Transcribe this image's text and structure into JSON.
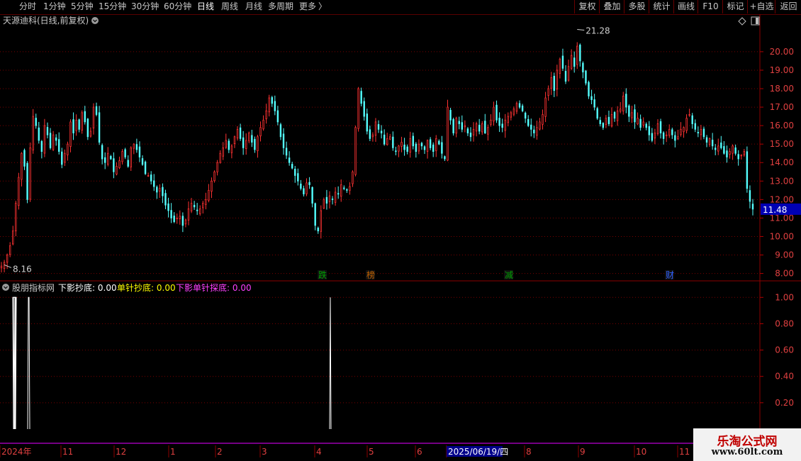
{
  "toolbar": {
    "periods": [
      "分时",
      "1分钟",
      "5分钟",
      "15分钟",
      "30分钟",
      "60分钟",
      "日线",
      "周线",
      "月线",
      "多周期",
      "更多"
    ],
    "active": "日线",
    "more_arrow": "〉",
    "right_buttons": [
      "复权",
      "叠加",
      "多股",
      "统计",
      "画线",
      "F10",
      "标记",
      "+自选",
      "返回"
    ]
  },
  "main_panel": {
    "title": "天源迪科(日线,前复权)",
    "high_label": "21.28",
    "low_label": "8.16",
    "current_price": "11.48",
    "y_ticks": [
      "20.00",
      "19.00",
      "18.00",
      "17.00",
      "16.00",
      "15.00",
      "14.00",
      "13.00",
      "12.00",
      "11.00",
      "10.00",
      "9.00",
      "8.00"
    ],
    "event_markers": [
      "跌",
      "榜",
      "减",
      "财"
    ]
  },
  "indicator_panel": {
    "name": "股朋指标网",
    "series": [
      {
        "name": "下影抄底",
        "value": "0.00",
        "color": "#ffffff"
      },
      {
        "name": "单针抄底",
        "value": "0.00",
        "color": "#ffff00"
      },
      {
        "name": "下影单针探底",
        "value": "0.00",
        "color": "#ff40ff"
      }
    ],
    "y_ticks": [
      "1.00",
      "0.80",
      "0.60",
      "0.40",
      "0.20"
    ]
  },
  "x_axis": {
    "labels": [
      "2024年",
      "11",
      "12",
      "1",
      "2",
      "3",
      "4",
      "5",
      "6",
      "2025/06/19/四",
      "8",
      "9",
      "10",
      "11"
    ]
  },
  "watermark": {
    "title": "乐淘公式网",
    "url": "www.60lt.com"
  },
  "chart_data": {
    "type": "candlestick",
    "price_ylim": [
      7.6,
      21.8
    ],
    "indicator_ylim": [
      0,
      1.05
    ],
    "closes": [
      8.4,
      8.6,
      9.0,
      9.5,
      10.3,
      11.8,
      13.2,
      14.5,
      13.8,
      12.0,
      14.8,
      16.5,
      16.0,
      15.2,
      14.6,
      16.0,
      15.5,
      14.8,
      15.5,
      15.2,
      14.6,
      13.9,
      14.5,
      15.0,
      16.2,
      15.6,
      16.3,
      15.8,
      16.7,
      16.2,
      15.4,
      15.7,
      17.0,
      16.6,
      15.1,
      14.2,
      14.0,
      14.5,
      14.2,
      13.5,
      13.8,
      14.1,
      14.6,
      14.3,
      13.8,
      14.8,
      15.0,
      14.7,
      14.3,
      13.9,
      13.4,
      13.3,
      13.0,
      12.7,
      12.4,
      12.6,
      12.2,
      11.7,
      11.4,
      11.0,
      10.8,
      11.0,
      11.1,
      10.6,
      10.9,
      11.5,
      11.8,
      11.6,
      11.4,
      11.5,
      11.8,
      12.0,
      12.5,
      13.0,
      13.5,
      14.0,
      14.5,
      14.8,
      15.2,
      14.7,
      14.9,
      15.4,
      15.8,
      15.3,
      14.8,
      15.2,
      15.6,
      15.1,
      14.7,
      15.4,
      15.9,
      16.3,
      16.8,
      17.5,
      17.2,
      16.8,
      16.2,
      15.4,
      14.8,
      14.4,
      14.0,
      13.7,
      13.3,
      13.0,
      12.6,
      12.3,
      12.9,
      12.8,
      11.8,
      10.6,
      10.3,
      11.4,
      12.0,
      11.8,
      12.2,
      12.0,
      12.4,
      12.3,
      12.8,
      12.6,
      12.5,
      12.7,
      13.5,
      15.9,
      18.0,
      17.2,
      16.5,
      15.7,
      15.3,
      15.5,
      16.2,
      15.8,
      15.6,
      15.0,
      15.3,
      15.4,
      14.8,
      14.6,
      14.9,
      15.1,
      14.7,
      14.6,
      15.3,
      14.9,
      14.6,
      15.0,
      14.9,
      14.7,
      15.2,
      14.8,
      14.6,
      15.3,
      15.0,
      14.5,
      14.2,
      17.0,
      16.3,
      15.6,
      16.4,
      16.1,
      15.8,
      16.0,
      15.6,
      15.4,
      15.8,
      16.1,
      15.7,
      16.1,
      15.6,
      15.9,
      16.3,
      17.0,
      16.3,
      16.0,
      15.9,
      16.3,
      16.5,
      16.7,
      16.9,
      17.2,
      17.0,
      16.8,
      16.4,
      16.0,
      15.8,
      15.6,
      15.9,
      16.2,
      16.6,
      17.5,
      18.0,
      18.6,
      17.9,
      19.0,
      19.6,
      19.1,
      18.4,
      19.2,
      19.8,
      19.2,
      20.3,
      19.5,
      18.9,
      18.3,
      17.6,
      17.4,
      17.0,
      16.4,
      16.1,
      15.9,
      16.4,
      16.1,
      16.6,
      16.4,
      16.8,
      16.9,
      17.6,
      17.0,
      16.5,
      16.7,
      16.2,
      16.4,
      15.9,
      16.2,
      15.9,
      15.5,
      15.2,
      15.6,
      16.1,
      15.6,
      15.3,
      15.5,
      15.8,
      15.5,
      15.2,
      15.4,
      15.8,
      15.9,
      16.4,
      16.6,
      16.1,
      15.8,
      15.6,
      15.8,
      15.4,
      15.1,
      15.3,
      14.9,
      14.7,
      14.9,
      14.8,
      14.5,
      14.3,
      14.6,
      14.9,
      14.5,
      14.2,
      14.4,
      14.6,
      12.6,
      11.9,
      11.48
    ],
    "indicator": {
      "spike_bar_ranges": [
        [
          18,
          19
        ],
        [
          19,
          20
        ],
        [
          20,
          22
        ],
        [
          37,
          42
        ],
        [
          463,
          467
        ]
      ]
    }
  }
}
